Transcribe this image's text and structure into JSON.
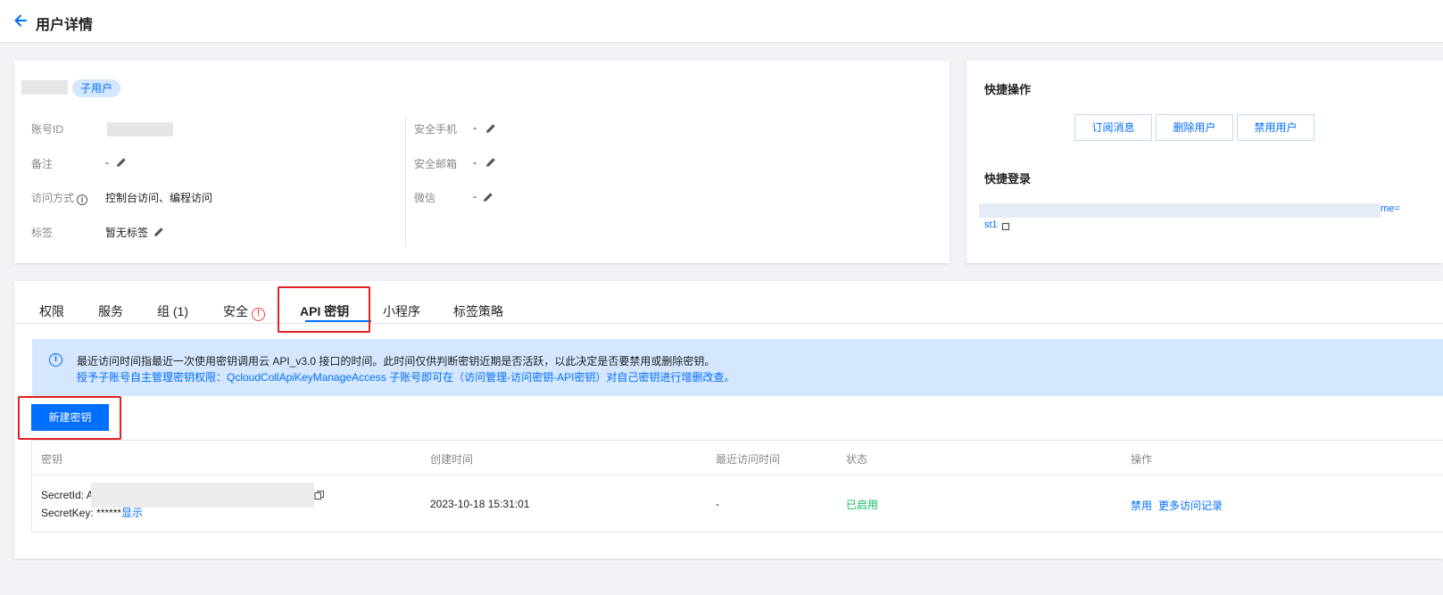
{
  "header": {
    "title": "用户详情"
  },
  "user": {
    "badge": "子用户",
    "fields_left": [
      {
        "label": "账号ID",
        "value": ""
      },
      {
        "label": "备注",
        "value": "-"
      },
      {
        "label": "访问方式",
        "value": "控制台访问、编程访问"
      },
      {
        "label": "标签",
        "value": "暂无标签"
      }
    ],
    "fields_right": [
      {
        "label": "安全手机",
        "value": "-"
      },
      {
        "label": "安全邮箱",
        "value": "-"
      },
      {
        "label": "微信",
        "value": "-"
      }
    ]
  },
  "quick_ops": {
    "title": "快捷操作",
    "buttons": [
      "订阅消息",
      "删除用户",
      "禁用用户"
    ],
    "login_title": "快捷登录",
    "login_link_tail": "me=",
    "login_link_line2": "st1"
  },
  "tabs": [
    {
      "label": "权限"
    },
    {
      "label": "服务"
    },
    {
      "label": "组 (1)"
    },
    {
      "label": "安全"
    },
    {
      "label": "API 密钥"
    },
    {
      "label": "小程序"
    },
    {
      "label": "标签策略"
    }
  ],
  "notice": {
    "line1": "最近访问时间指最近一次使用密钥调用云 API_v3.0 接口的时间。此时间仅供判断密钥近期是否活跃，以此决定是否要禁用或删除密钥。",
    "line2": "授予子账号自主管理密钥权限：QcloudCollApiKeyManageAccess 子账号即可在（访问管理-访问密钥-API密钥）对自己密钥进行增删改查。"
  },
  "new_key_button": "新建密钥",
  "table": {
    "headers": [
      "密钥",
      "创建时间",
      "最近访问时间",
      "状态",
      "操作"
    ],
    "rows": [
      {
        "secret_id_label": "SecretId: A",
        "secret_key_label": "SecretKey: ******",
        "show_link": "显示",
        "created": "2023-10-18 15:31:01",
        "last_access": "-",
        "status": "已启用",
        "action_disable": "禁用",
        "action_more": "更多访问记录"
      }
    ]
  },
  "colors": {
    "accent": "#006eff",
    "success": "#0abf5b",
    "danger": "#e54545",
    "highlight": "#e02020"
  }
}
